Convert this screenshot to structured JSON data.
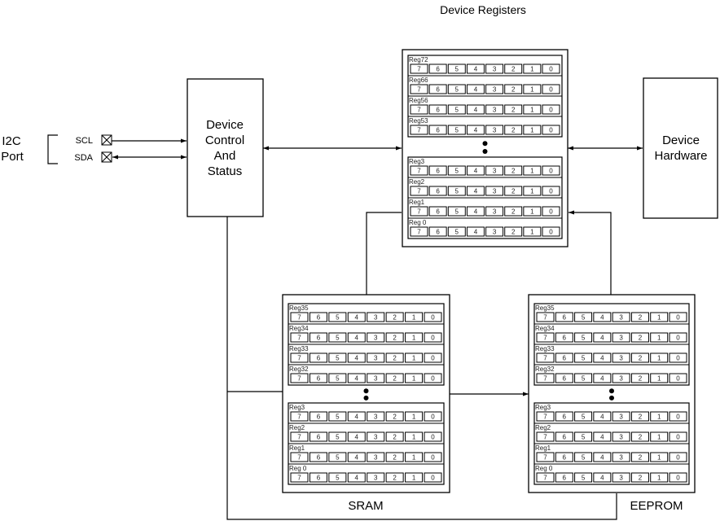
{
  "title": "Device Registers",
  "i2c_port": {
    "label_lines": [
      "I2C",
      "Port"
    ],
    "pins": [
      {
        "name": "SCL",
        "direction": "in"
      },
      {
        "name": "SDA",
        "direction": "bidirectional"
      }
    ]
  },
  "blocks": {
    "control": {
      "label_lines": [
        "Device",
        "Control",
        "And",
        "Status"
      ]
    },
    "hardware": {
      "label_lines": [
        "Device",
        "Hardware"
      ]
    }
  },
  "bits": [
    "7",
    "6",
    "5",
    "4",
    "3",
    "2",
    "1",
    "0"
  ],
  "register_banks": [
    {
      "id": "device-registers",
      "caption": "",
      "upper_registers": [
        "Reg72",
        "Reg66",
        "Reg56",
        "Reg53"
      ],
      "lower_registers": [
        "Reg3",
        "Reg2",
        "Reg1",
        "Reg 0"
      ]
    },
    {
      "id": "sram",
      "caption": "SRAM",
      "upper_registers": [
        "Reg35",
        "Reg34",
        "Reg33",
        "Reg32"
      ],
      "lower_registers": [
        "Reg3",
        "Reg2",
        "Reg1",
        "Reg 0"
      ]
    },
    {
      "id": "eeprom",
      "caption": "EEPROM",
      "upper_registers": [
        "Reg35",
        "Reg34",
        "Reg33",
        "Reg32"
      ],
      "lower_registers": [
        "Reg3",
        "Reg2",
        "Reg1",
        "Reg 0"
      ]
    }
  ],
  "connections": [
    {
      "from": "SCL",
      "to": "Device Control And Status",
      "type": "arrow"
    },
    {
      "from": "SDA",
      "to": "Device Control And Status",
      "type": "bidirectional"
    },
    {
      "from": "Device Control And Status",
      "to": "Device Registers",
      "type": "bidirectional"
    },
    {
      "from": "Device Registers",
      "to": "Device Hardware",
      "type": "bidirectional"
    },
    {
      "from": "SRAM",
      "to": "Device Registers",
      "type": "line"
    },
    {
      "from": "EEPROM",
      "to": "Device Registers",
      "type": "arrow"
    },
    {
      "from": "SRAM",
      "to": "EEPROM",
      "type": "arrow"
    },
    {
      "from": "Device Control And Status",
      "to": "SRAM",
      "type": "line"
    },
    {
      "from": "Device Control And Status",
      "to": "EEPROM",
      "type": "line"
    }
  ]
}
